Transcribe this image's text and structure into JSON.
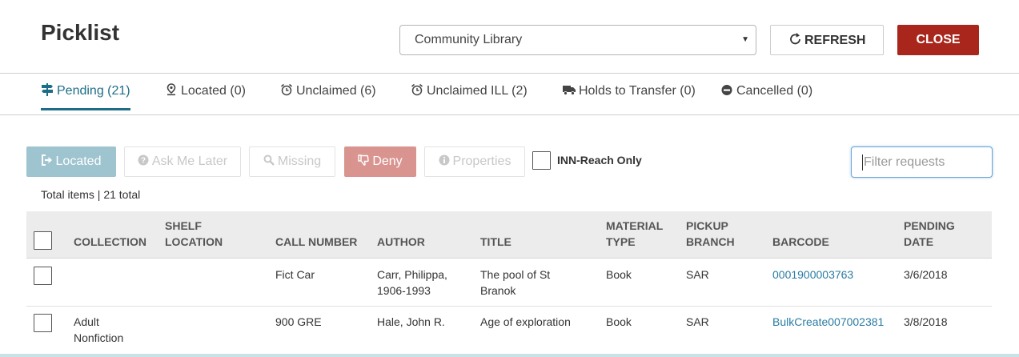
{
  "header": {
    "title": "Picklist",
    "branch_select": {
      "value": "Community Library"
    },
    "refresh_label": "REFRESH",
    "close_label": "CLOSE"
  },
  "tabs": [
    {
      "label": "Pending (21)",
      "icon": "signpost-icon",
      "active": true
    },
    {
      "label": "Located (0)",
      "icon": "map-marker-icon",
      "active": false
    },
    {
      "label": "Unclaimed (6)",
      "icon": "alarm-clock-icon",
      "active": false
    },
    {
      "label": "Unclaimed ILL (2)",
      "icon": "alarm-clock-icon",
      "active": false
    },
    {
      "label": "Holds to Transfer (0)",
      "icon": "truck-icon",
      "active": false
    },
    {
      "label": "Cancelled (0)",
      "icon": "minus-circle-icon",
      "active": false
    }
  ],
  "toolbar": {
    "located_label": "Located",
    "ask_later_label": "Ask Me Later",
    "missing_label": "Missing",
    "deny_label": "Deny",
    "properties_label": "Properties",
    "inn_reach_label": "INN-Reach Only",
    "filter_placeholder": "Filter requests"
  },
  "total_items": "Total items | 21 total",
  "table": {
    "columns": {
      "collection": "COLLECTION",
      "shelf_1": "SHELF",
      "shelf_2": "LOCATION",
      "call_number": "CALL NUMBER",
      "author": "AUTHOR",
      "title": "TITLE",
      "material_1": "MATERIAL",
      "material_2": "TYPE",
      "pickup_1": "PICKUP",
      "pickup_2": "BRANCH",
      "barcode": "BARCODE",
      "pending_1": "PENDING",
      "pending_2": "DATE"
    },
    "rows": [
      {
        "collection_1": "",
        "collection_2": "",
        "shelf_location": "",
        "call_number": "Fict Car",
        "author_1": "Carr, Philippa,",
        "author_2": "1906-1993",
        "title_1": "The pool of St",
        "title_2": "Branok",
        "material_type": "Book",
        "pickup_branch": "SAR",
        "barcode": "0001900003763",
        "pending_date": "3/6/2018"
      },
      {
        "collection_1": "Adult",
        "collection_2": "Nonfiction",
        "shelf_location": "",
        "call_number": "900 GRE",
        "author_1": "Hale, John R.",
        "author_2": "",
        "title_1": "Age of exploration",
        "title_2": "",
        "material_type": "Book",
        "pickup_branch": "SAR",
        "barcode": "BulkCreate007002381",
        "pending_date": "3/8/2018"
      }
    ]
  },
  "colors": {
    "accent": "#1d6d88",
    "close": "#a8261b",
    "located_btn": "#9ec4cf",
    "deny_btn": "#d9948f",
    "link": "#2a7ca3"
  }
}
